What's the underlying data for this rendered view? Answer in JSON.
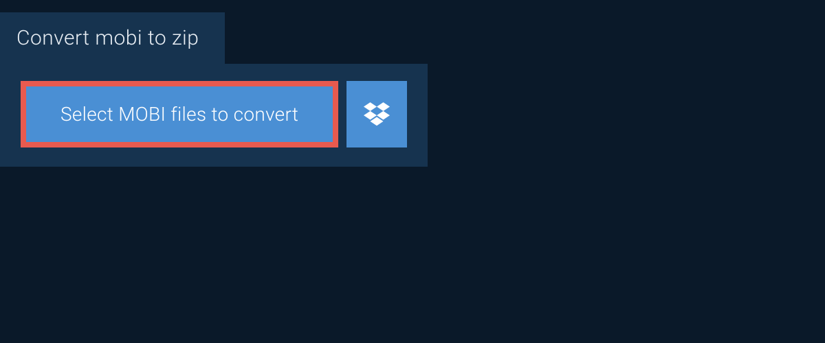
{
  "tab": {
    "label": "Convert mobi to zip"
  },
  "actions": {
    "select_files_label": "Select MOBI files to convert"
  },
  "colors": {
    "background": "#0a1929",
    "panel": "#16334f",
    "button": "#4a8fd4",
    "highlight_border": "#e85a4f",
    "text_light": "#ffffff"
  }
}
